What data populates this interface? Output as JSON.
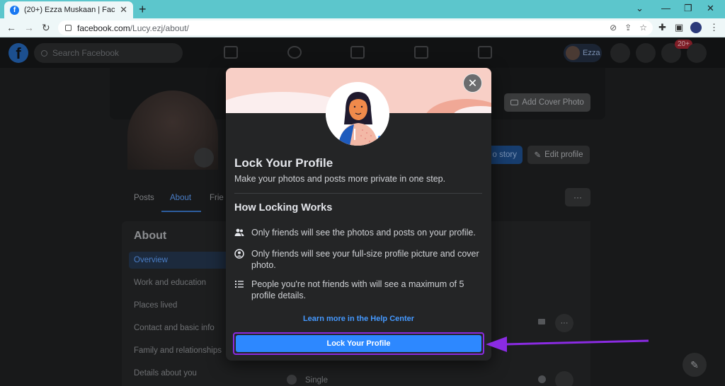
{
  "browser": {
    "tab_title": "(20+) Ezza Muskaan | Facebook",
    "url_domain": "facebook.com",
    "url_path": "/Lucy.ezj/about/"
  },
  "fb": {
    "search_placeholder": "Search Facebook",
    "user_name": "Ezza",
    "notif_count": "20+",
    "add_cover_label": "Add Cover Photo",
    "story_label": "o story",
    "edit_profile_label": "Edit profile",
    "profile_tabs": [
      "Posts",
      "About",
      "Frie"
    ],
    "about_title": "About",
    "about_items": [
      "Overview",
      "Work and education",
      "Places lived",
      "Contact and basic info",
      "Family and relationships",
      "Details about you"
    ],
    "relationship": "Single"
  },
  "modal": {
    "title": "Lock Your Profile",
    "subtitle": "Make your photos and posts more private in one step.",
    "section_title": "How Locking Works",
    "points": [
      {
        "icon": "friends-icon",
        "text": "Only friends will see the photos and posts on your profile."
      },
      {
        "icon": "profile-circle-icon",
        "text": "Only friends will see your full-size profile picture and cover photo."
      },
      {
        "icon": "list-icon",
        "text": "People you're not friends with will see a maximum of 5 profile details."
      }
    ],
    "help_link": "Learn more in the Help Center",
    "button_label": "Lock Your Profile"
  },
  "colors": {
    "accent": "#2d88ff",
    "highlight_outline": "#8a2be2",
    "arrow": "#8a2be2"
  }
}
